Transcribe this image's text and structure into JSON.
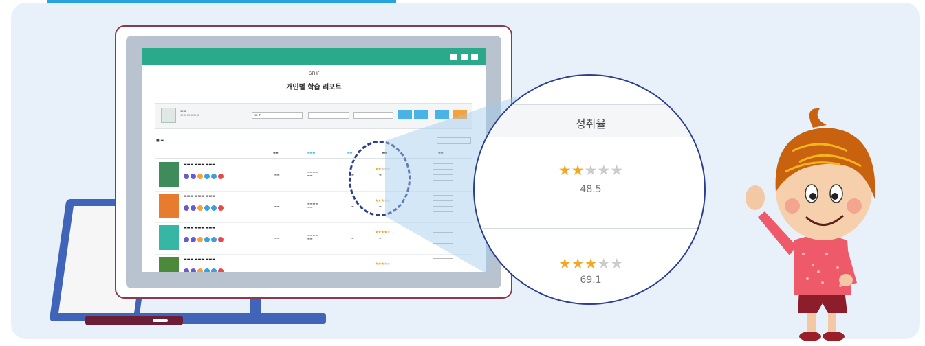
{
  "report": {
    "subtitle": "GTHF",
    "title": "개인별 학습 리포트"
  },
  "magnifier": {
    "header": "성취율",
    "rating_1": {
      "stars": 2,
      "max": 5,
      "score": "48.5"
    },
    "rating_2": {
      "stars": 3,
      "max": 5,
      "score": "69.1"
    }
  },
  "colors": {
    "header_green": "#2aaa8a",
    "accent_blue": "#29a3e0",
    "frame_navy": "#2c3f8f",
    "star_gold": "#f4a71f",
    "star_grey": "#cccccc"
  },
  "icons": [
    "star-icon",
    "window-control-icon",
    "avatar-icon"
  ]
}
